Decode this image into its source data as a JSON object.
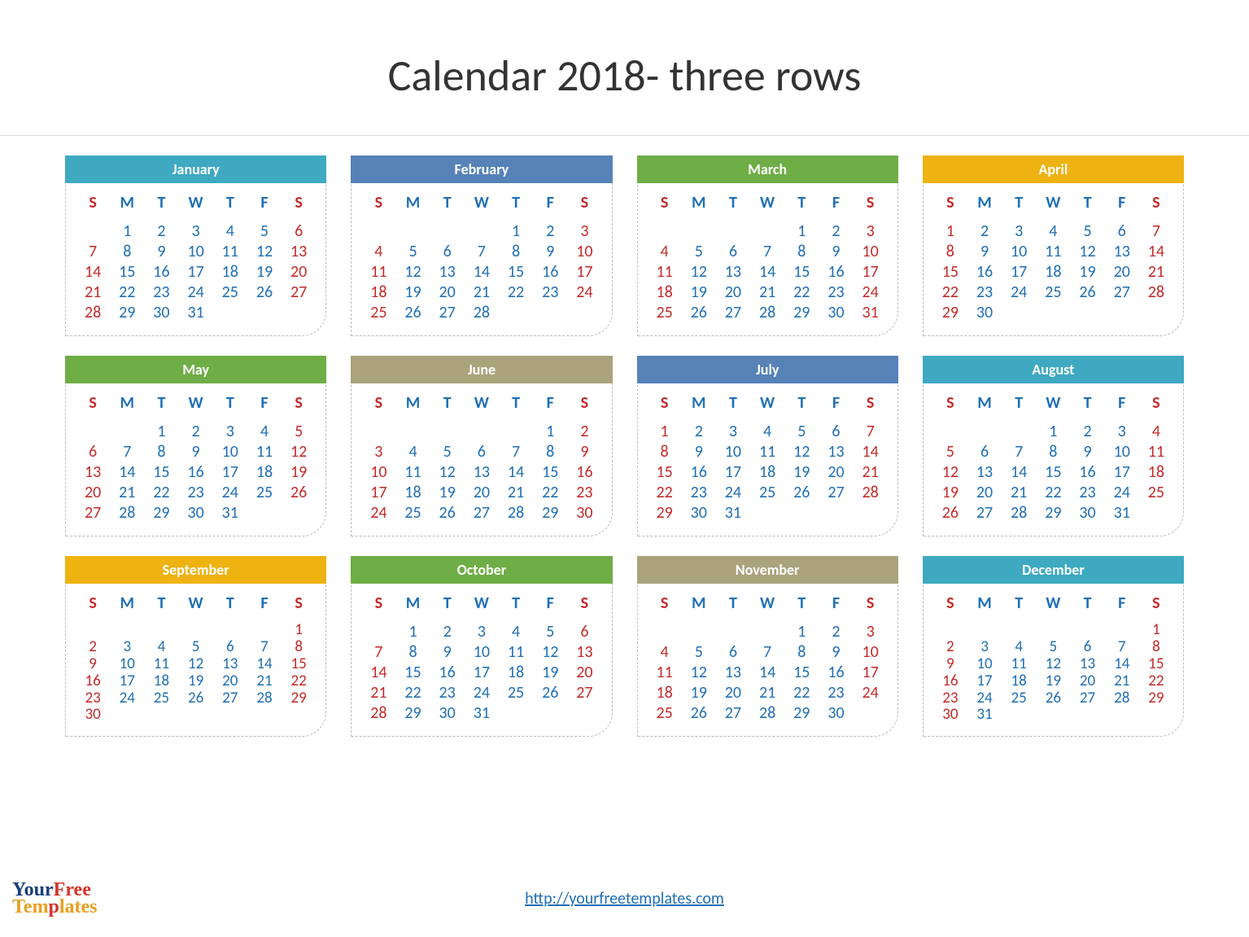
{
  "title": "Calendar 2018- three rows",
  "footer_link": "http://yourfreetemplates.com",
  "logo": {
    "part1": "Your",
    "part2": "Free",
    "part3": "Tem",
    "part4": "p",
    "part5": "lates"
  },
  "day_headers": [
    "S",
    "M",
    "T",
    "W",
    "T",
    "F",
    "S"
  ],
  "months": [
    {
      "name": "January",
      "color": "c-teal",
      "start": 1,
      "days": 31,
      "compact": false
    },
    {
      "name": "February",
      "color": "c-blue",
      "start": 4,
      "days": 28,
      "compact": false
    },
    {
      "name": "March",
      "color": "c-green",
      "start": 4,
      "days": 31,
      "compact": false
    },
    {
      "name": "April",
      "color": "c-gold",
      "start": 0,
      "days": 30,
      "compact": false
    },
    {
      "name": "May",
      "color": "c-green",
      "start": 2,
      "days": 31,
      "compact": false
    },
    {
      "name": "June",
      "color": "c-tan",
      "start": 5,
      "days": 30,
      "compact": false
    },
    {
      "name": "July",
      "color": "c-blue",
      "start": 0,
      "days": 31,
      "compact": false
    },
    {
      "name": "August",
      "color": "c-teal",
      "start": 3,
      "days": 31,
      "compact": false
    },
    {
      "name": "September",
      "color": "c-gold",
      "start": 6,
      "days": 30,
      "compact": true
    },
    {
      "name": "October",
      "color": "c-green",
      "start": 1,
      "days": 31,
      "compact": false
    },
    {
      "name": "November",
      "color": "c-tan",
      "start": 4,
      "days": 30,
      "compact": false
    },
    {
      "name": "December",
      "color": "c-teal",
      "start": 6,
      "days": 31,
      "compact": true
    }
  ]
}
